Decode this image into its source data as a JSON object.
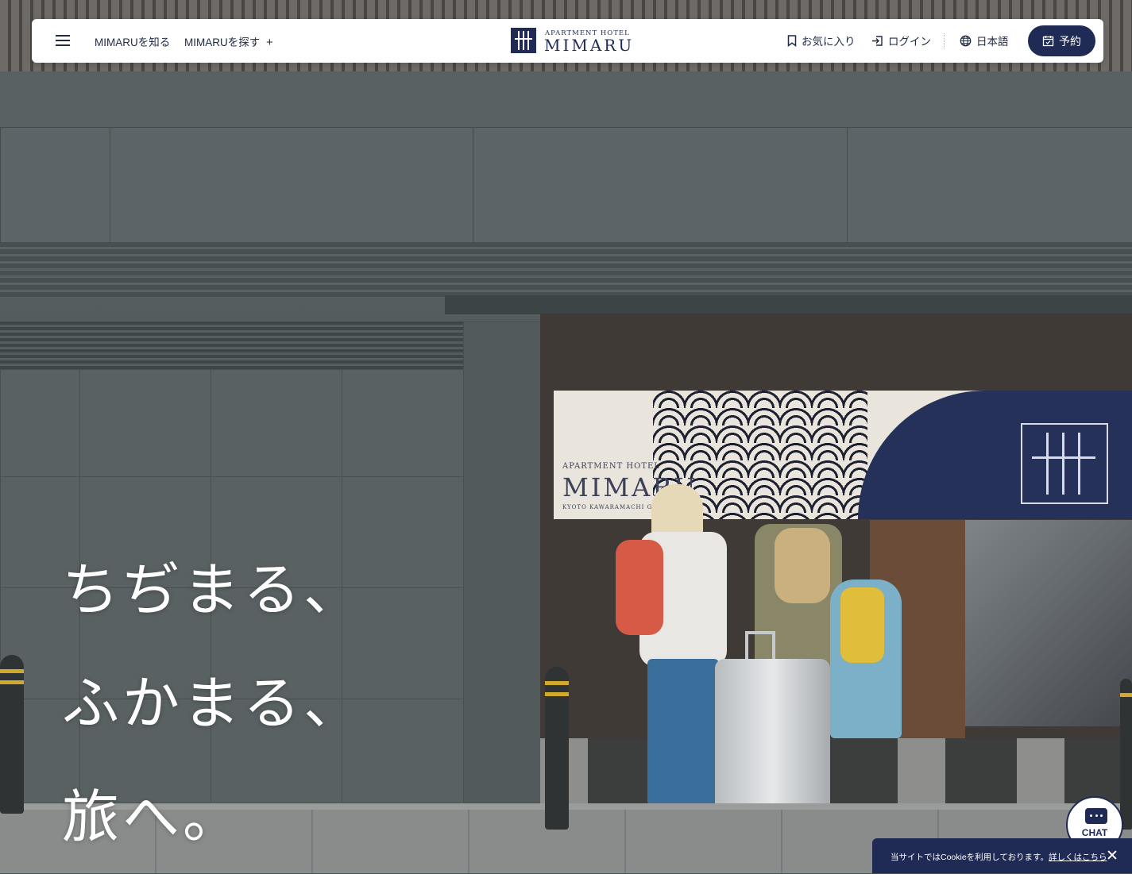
{
  "header": {
    "menu_icon": "hamburger-menu-icon",
    "nav": [
      {
        "label": "MIMARUを知る"
      },
      {
        "label": "MIMARUを探す",
        "expand_icon": "+"
      }
    ],
    "logo": {
      "sub": "APARTMENT HOTEL",
      "main": "MIMARU"
    },
    "favorites_label": "お気に入り",
    "favorites_icon": "bookmark-icon",
    "login_label": "ログイン",
    "login_icon": "login-icon",
    "language_label": "日本語",
    "language_icon": "globe-icon",
    "reserve_label": "予約",
    "reserve_icon": "calendar-icon"
  },
  "hero": {
    "copy_lines": [
      "ちぢまる、",
      "ふかまる、",
      "旅へ。"
    ],
    "noren": {
      "sub": "APARTMENT HOTEL",
      "main": "MIMARU",
      "location": "KYOTO KAWARAMACHI G"
    }
  },
  "chat": {
    "label": "CHAT",
    "icon": "chat-bubble-icon"
  },
  "cookie": {
    "text": "当サイトではCookieを利用しております。",
    "link": "詳しくはこちら",
    "close_icon": "close-icon"
  },
  "colors": {
    "brand_navy": "#1f2a55",
    "header_bg": "#ffffff",
    "text": "#1f2a44"
  }
}
